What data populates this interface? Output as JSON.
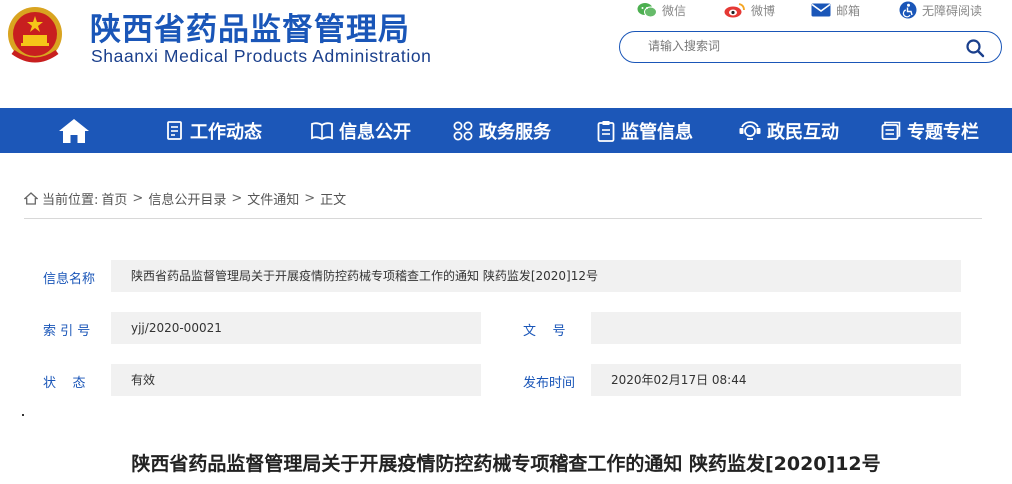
{
  "header": {
    "site_title": "陕西省药品监督管理局",
    "site_subtitle": "Shaanxi Medical Products Administration",
    "emblem_icon": "national-emblem-icon"
  },
  "toplinks": [
    {
      "label": "微信",
      "icon": "wechat-icon"
    },
    {
      "label": "微博",
      "icon": "weibo-icon"
    },
    {
      "label": "邮箱",
      "icon": "mail-icon"
    },
    {
      "label": "无障碍阅读",
      "icon": "accessibility-icon"
    }
  ],
  "search": {
    "placeholder": "请输入搜索词",
    "icon": "search-icon"
  },
  "nav": {
    "home_icon": "home-icon",
    "items": [
      {
        "label": "工作动态",
        "icon": "document-list-icon"
      },
      {
        "label": "信息公开",
        "icon": "open-book-icon"
      },
      {
        "label": "政务服务",
        "icon": "grid-circles-icon"
      },
      {
        "label": "监管信息",
        "icon": "clipboard-icon"
      },
      {
        "label": "政民互动",
        "icon": "interaction-icon"
      },
      {
        "label": "专题专栏",
        "icon": "folder-icon"
      }
    ]
  },
  "breadcrumb": {
    "prefix": "当前位置:",
    "items": [
      "首页",
      "信息公开目录",
      "文件通知",
      "正文"
    ],
    "separator": ">"
  },
  "info": {
    "name_label": "信息名称",
    "name_value": "陕西省药品监督管理局关于开展疫情防控药械专项稽查工作的通知 陕药监发[2020]12号",
    "index_label": "索 引 号",
    "index_value": "yjj/2020-00021",
    "doc_label": "文    号",
    "doc_value": "",
    "status_label": "状    态",
    "status_value": "有效",
    "date_label": "发布时间",
    "date_value": "2020年02月17日 08:44"
  },
  "article": {
    "title": "陕西省药品监督管理局关于开展疫情防控药械专项稽查工作的通知 陕药监发[2020]12号"
  },
  "colors": {
    "brand": "#1c57b8",
    "field_bg": "#f1f1f1"
  }
}
